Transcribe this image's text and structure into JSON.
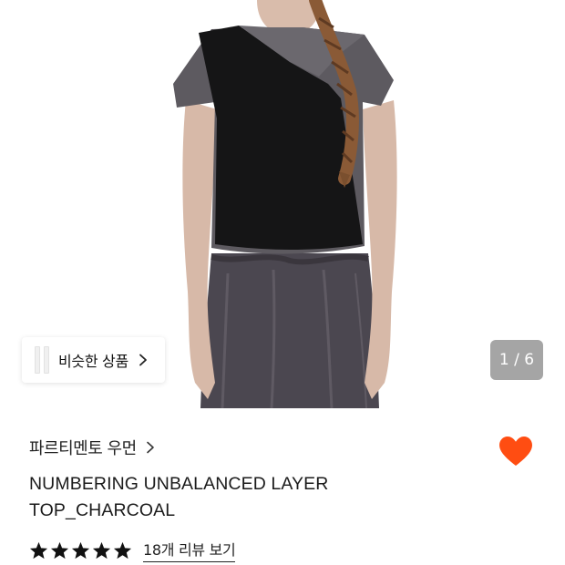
{
  "gallery": {
    "similar_label": "비슷한 상품",
    "counter": "1 / 6"
  },
  "product": {
    "brand": "파르티멘토 우먼",
    "title_line1": "NUMBERING UNBALANCED LAYER",
    "title_line2": "TOP_CHARCOAL",
    "rating_stars": 5,
    "review_link": "18개 리뷰 보기",
    "liked": true
  },
  "colors": {
    "heart": "#ff4d12",
    "counter_bg": "#8c8c8c",
    "text": "#111111"
  }
}
